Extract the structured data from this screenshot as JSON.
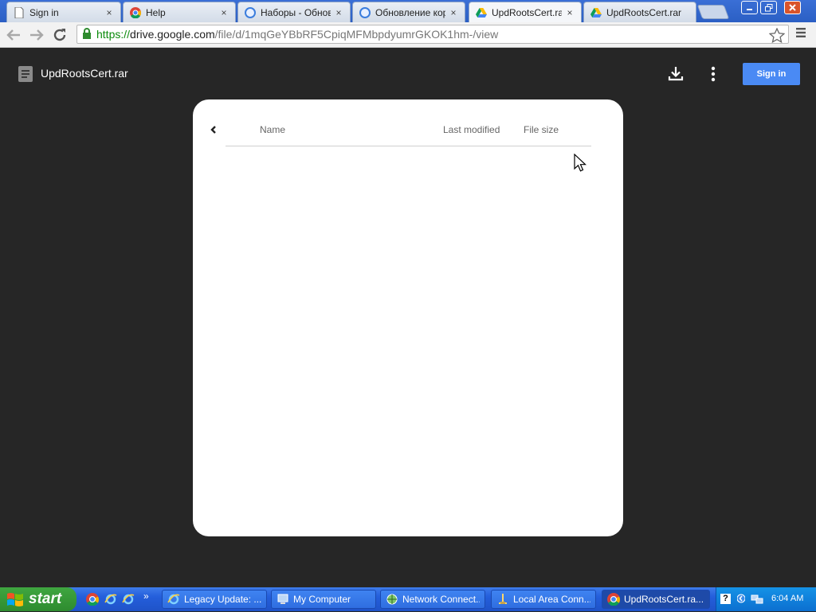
{
  "browser": {
    "tabs": [
      {
        "label": "Sign in",
        "icon": "page-icon"
      },
      {
        "label": "Help",
        "icon": "chrome-icon"
      },
      {
        "label": "Наборы - Обновл",
        "icon": "legacy-update-icon"
      },
      {
        "label": "Обновление корн",
        "icon": "legacy-update-icon"
      },
      {
        "label": "UpdRootsCert.rar",
        "icon": "google-drive-icon",
        "active": true
      },
      {
        "label": "UpdRootsCert.rar",
        "icon": "google-drive-icon"
      }
    ],
    "close_glyph": "×",
    "url": {
      "scheme": "https://",
      "domain": "drive.google.com",
      "path": "/file/d/1mqGeYBbRF5CpiqMFMbpdyumrGKOK1hm-/view"
    }
  },
  "drive": {
    "file_title": "UpdRootsCert.rar",
    "sign_in_label": "Sign in",
    "columns": {
      "name": "Name",
      "last_modified": "Last modified",
      "file_size": "File size"
    }
  },
  "taskbar": {
    "start_label": "start",
    "overflow_glyph": "»",
    "tasks": [
      {
        "label": "Legacy Update: ...",
        "icon": "ie-icon"
      },
      {
        "label": "My Computer",
        "icon": "computer-icon"
      },
      {
        "label": "Network Connect...",
        "icon": "network-icon"
      },
      {
        "label": "Local Area Conn...",
        "icon": "network-icon"
      },
      {
        "label": "UpdRootsCert.ra...",
        "icon": "chrome-icon",
        "active": true
      }
    ],
    "clock": "6:04 AM"
  },
  "colors": {
    "page_background": "#262626",
    "sign_in_button": "#4a8af4",
    "taskbar": "#245edb",
    "start_button": "#3fa640"
  }
}
